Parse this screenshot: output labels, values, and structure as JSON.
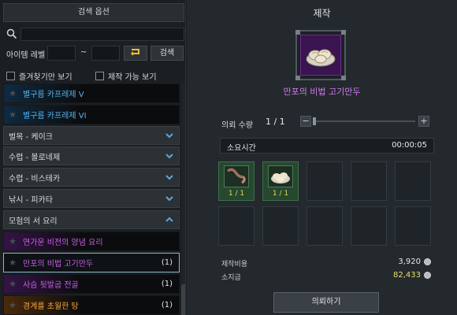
{
  "left": {
    "title": "검색 옵션",
    "search": {
      "value": "",
      "placeholder": ""
    },
    "level_label": "아이템 레벨",
    "level_separator": "~",
    "search_button": "검색",
    "favorites_only": "즐겨찾기만 보기",
    "craftable_only": "제작 가능 보기",
    "list": [
      {
        "kind": "recipe",
        "label": "별구름 카프레제 V",
        "count": "",
        "color": "blue"
      },
      {
        "kind": "recipe",
        "label": "별구름 카프레제 VI",
        "count": "",
        "color": "blue"
      },
      {
        "kind": "category",
        "label": "벌목 - 케이크",
        "expanded": false
      },
      {
        "kind": "category",
        "label": "수렵 - 볼로네제",
        "expanded": false
      },
      {
        "kind": "category",
        "label": "수렵 - 비스테카",
        "expanded": false
      },
      {
        "kind": "category",
        "label": "낚시 - 피카타",
        "expanded": false
      },
      {
        "kind": "category",
        "label": "모험의 서 요리",
        "expanded": true
      },
      {
        "kind": "recipe",
        "label": "연가운 비전의 양념 요리",
        "count": "",
        "color": "purple"
      },
      {
        "kind": "recipe",
        "label": "만포의 비법 고기만두",
        "count": "(1)",
        "color": "purple",
        "selected": true
      },
      {
        "kind": "recipe",
        "label": "사슴 뒷발굽 전골",
        "count": "(1)",
        "color": "purple"
      },
      {
        "kind": "recipe",
        "label": "경계를 초월한 탕",
        "count": "(1)",
        "color": "gold"
      }
    ]
  },
  "right": {
    "title": "제작",
    "item_name": "만포의 비법 고기만두",
    "item_icon": "dumpling-icon",
    "quantity_label": "의뢰 수량",
    "quantity_value": "1 / 1",
    "quantity_fraction": 0,
    "time_label": "소요시간",
    "time_value": "00:00:05",
    "materials": [
      {
        "icon": "worm-bait-icon",
        "count": "1 / 1"
      },
      {
        "icon": "dumpling-icon",
        "count": "1 / 1"
      }
    ],
    "cost_label": "제작비용",
    "cost_value": "3,920",
    "owned_label": "소지금",
    "owned_value": "82,433",
    "request_button": "의뢰하기"
  },
  "colors": {
    "blue_recipe": "#5ab4ef",
    "purple_recipe": "#c760e6",
    "gold_recipe": "#f2a33a",
    "material_count": "#e8d55a",
    "owned_gold": "#e9df6d"
  }
}
